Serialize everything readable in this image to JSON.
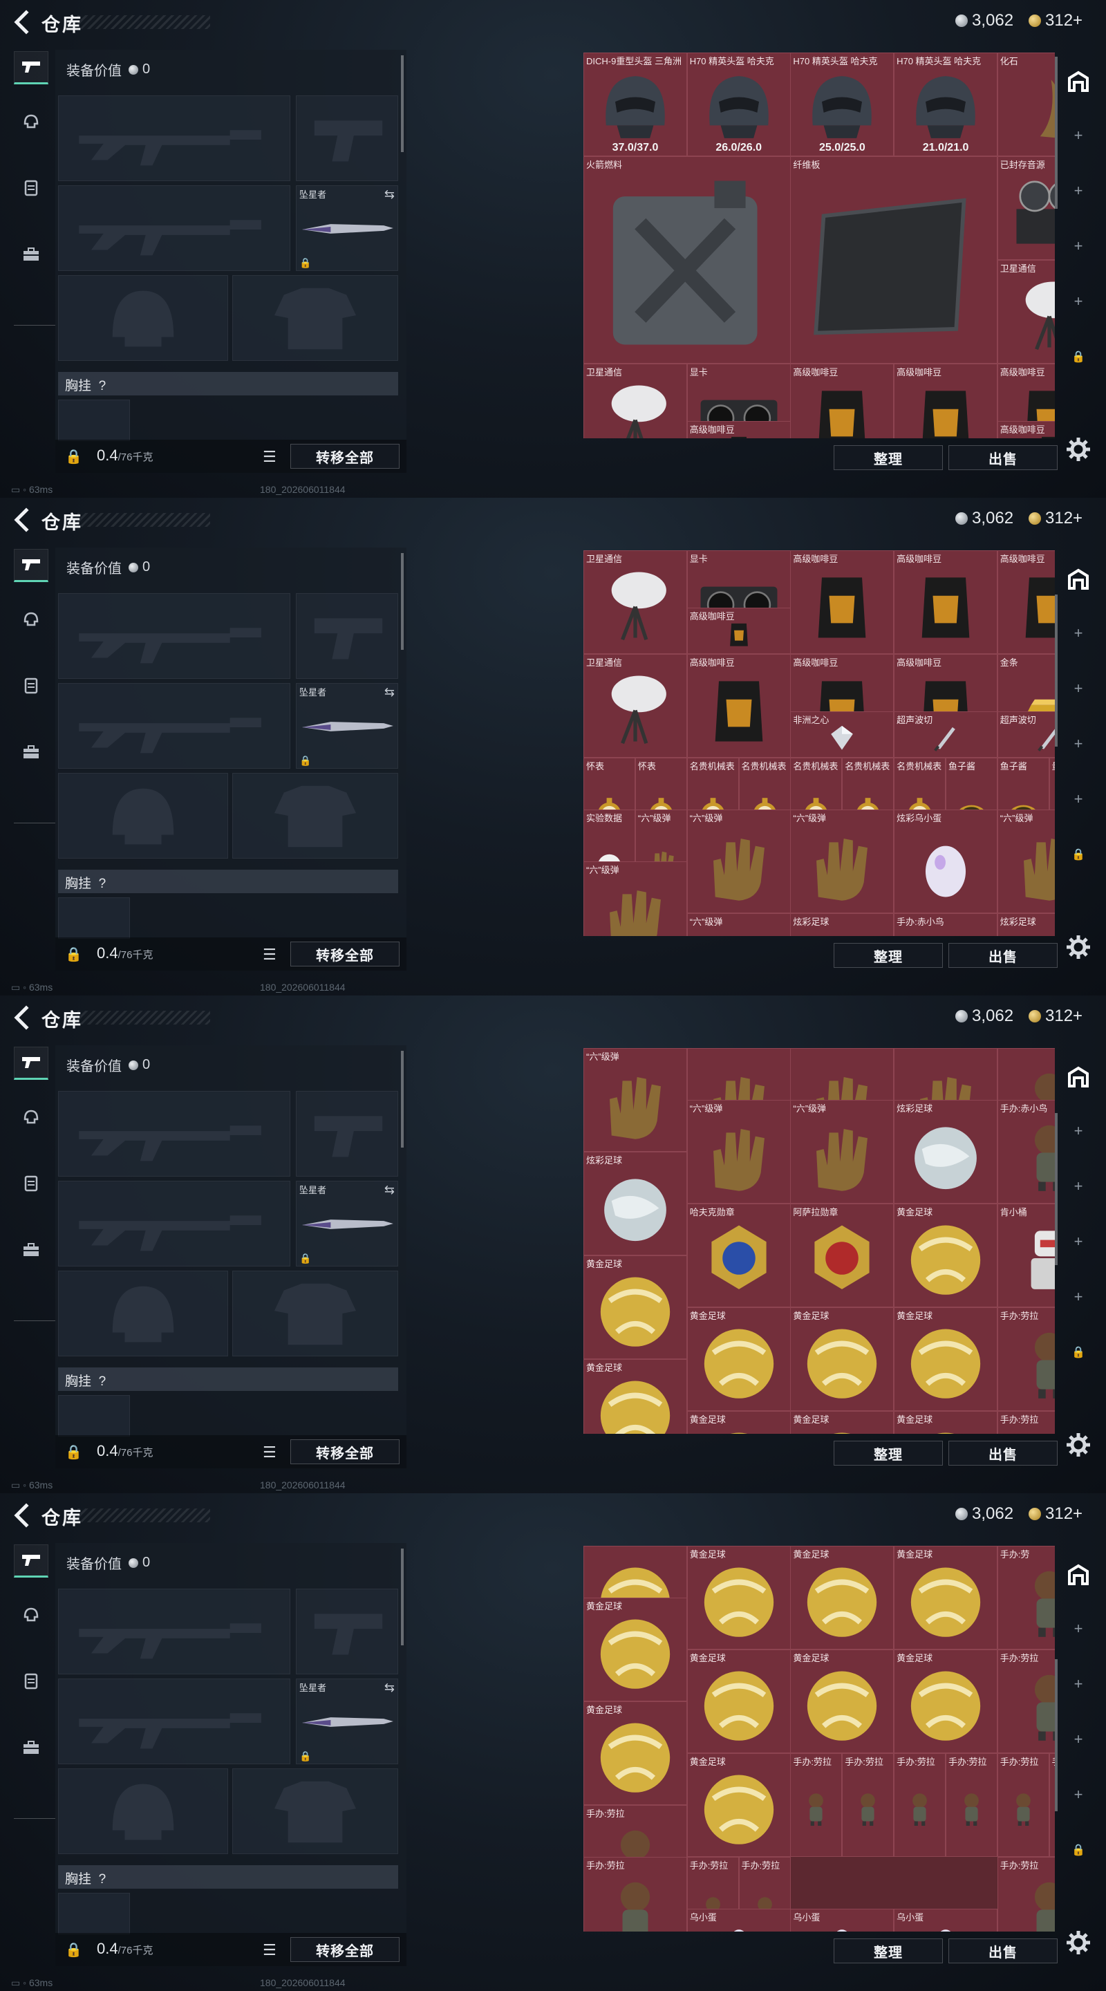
{
  "header": {
    "title": "仓库",
    "silver": "3,062",
    "gold": "312+"
  },
  "loadout": {
    "value_label": "装备价值",
    "value": "0",
    "secondary_label": "坠星者",
    "chest_label": "胸挂",
    "chest_q": "?",
    "weight": "0.4",
    "weight_max": "/76千克",
    "transfer_all": "转移全部"
  },
  "actions": {
    "sort": "整理",
    "sell": "出售"
  },
  "status": {
    "ping": "63ms",
    "build": "180_202606011844"
  },
  "storage": [
    [
      {
        "n": "DICH-9重型头盔 三角洲",
        "d": "37.0/37.0",
        "i": "helmet"
      },
      {
        "n": "H70 精英头盔 哈夫克",
        "d": "26.0/26.0",
        "i": "helmet"
      },
      {
        "n": "H70 精英头盔 哈夫克",
        "d": "25.0/25.0",
        "i": "helmet"
      },
      {
        "n": "H70 精英头盔 哈夫克",
        "d": "21.0/21.0",
        "i": "helmet"
      },
      {
        "n": "化石",
        "i": "fossil"
      },
      {
        "n": "火箭燃料",
        "i": "fuel"
      },
      {
        "n": "纤维板",
        "i": "board"
      },
      {
        "n": "已封存音源",
        "i": "reel"
      },
      {
        "n": "卫星通信",
        "i": "dish"
      },
      {
        "n": "卫星通信",
        "i": "dish"
      },
      {
        "n": "显卡",
        "i": "gpu"
      },
      {
        "n": "高级咖啡豆",
        "i": "coffee"
      },
      {
        "n": "高级咖啡豆",
        "i": "coffee"
      },
      {
        "n": "高级咖啡豆",
        "i": "coffee"
      },
      {
        "n": "高级咖啡豆",
        "i": "coffee"
      },
      {
        "n": "高级咖啡豆",
        "i": "coffee"
      },
      {
        "n": "高级咖啡豆",
        "i": "coffee"
      },
      {
        "n": "高级咖啡豆",
        "i": "coffee"
      },
      {
        "n": "金条",
        "i": "gold"
      },
      {
        "n": "非洲之心",
        "i": "gem"
      },
      {
        "n": "超声波切",
        "i": "knife"
      },
      {
        "n": "超声波切",
        "i": "knife"
      }
    ],
    [
      {
        "n": "卫星通信",
        "i": "dish"
      },
      {
        "n": "显卡",
        "i": "gpu"
      },
      {
        "n": "高级咖啡豆",
        "i": "coffee"
      },
      {
        "n": "高级咖啡豆",
        "i": "coffee"
      },
      {
        "n": "高级咖啡豆",
        "i": "coffee"
      },
      {
        "n": "卫星通信",
        "i": "dish"
      },
      {
        "n": "高级咖啡豆",
        "i": "coffee"
      },
      {
        "n": "高级咖啡豆",
        "i": "coffee"
      },
      {
        "n": "高级咖啡豆",
        "i": "coffee"
      },
      {
        "n": "高级咖啡豆",
        "i": "coffee"
      },
      {
        "n": "金条",
        "i": "gold"
      },
      {
        "n": "非洲之心",
        "i": "gem"
      },
      {
        "n": "超声波切",
        "i": "knife"
      },
      {
        "n": "超声波切",
        "i": "knife"
      },
      {
        "n": "怀表",
        "i": "watch"
      },
      {
        "n": "怀表",
        "i": "watch"
      },
      {
        "n": "名贵机械表",
        "i": "watch"
      },
      {
        "n": "名贵机械表",
        "i": "watch"
      },
      {
        "n": "名贵机械表",
        "i": "watch"
      },
      {
        "n": "名贵机械表",
        "i": "watch"
      },
      {
        "n": "名贵机械表",
        "i": "watch"
      },
      {
        "n": "鱼子酱",
        "i": "tin"
      },
      {
        "n": "鱼子酱",
        "i": "tin"
      },
      {
        "n": "量子存储",
        "i": "usb"
      },
      {
        "n": "实验数据",
        "i": "disc"
      },
      {
        "n": "“六”级弹",
        "i": "hand"
      },
      {
        "n": "“六”级弹",
        "i": "hand"
      },
      {
        "n": "“六”级弹",
        "i": "hand"
      },
      {
        "n": "炫彩乌小蛋",
        "i": "egg"
      },
      {
        "n": "“六”级弹",
        "i": "hand"
      },
      {
        "n": "“六”级弹",
        "i": "hand"
      },
      {
        "n": "“六”级弹",
        "i": "hand"
      },
      {
        "n": "炫彩足球",
        "i": "pearl"
      },
      {
        "n": "手办:赤小鸟",
        "i": "figure"
      },
      {
        "n": "炫彩足球",
        "i": "pearl"
      }
    ],
    [
      {
        "n": "“六”级弹",
        "i": "hand"
      },
      {
        "n": "",
        "i": "hand"
      },
      {
        "n": "",
        "i": "hand"
      },
      {
        "n": "",
        "i": "hand"
      },
      {
        "n": "",
        "i": "figure"
      },
      {
        "n": "“六”级弹",
        "i": "hand"
      },
      {
        "n": "“六”级弹",
        "i": "hand"
      },
      {
        "n": "炫彩足球",
        "i": "pearl"
      },
      {
        "n": "手办:赤小鸟",
        "i": "figure"
      },
      {
        "n": "炫彩足球",
        "i": "pearl"
      },
      {
        "n": "哈夫克勋章",
        "i": "medalb"
      },
      {
        "n": "阿萨拉勋章",
        "i": "medalr"
      },
      {
        "n": "黄金足球",
        "i": "ball"
      },
      {
        "n": "肯小桶",
        "i": "robot"
      },
      {
        "n": "黄金足球",
        "i": "ball"
      },
      {
        "n": "黄金足球",
        "i": "ball"
      },
      {
        "n": "黄金足球",
        "i": "ball"
      },
      {
        "n": "黄金足球",
        "i": "ball"
      },
      {
        "n": "手办:劳拉",
        "i": "figure"
      },
      {
        "n": "黄金足球",
        "i": "ball"
      },
      {
        "n": "黄金足球",
        "i": "ball"
      },
      {
        "n": "黄金足球",
        "i": "ball"
      },
      {
        "n": "黄金足球",
        "i": "ball"
      },
      {
        "n": "手办:劳拉",
        "i": "figure"
      }
    ],
    [
      {
        "n": "",
        "i": "ball"
      },
      {
        "n": "黄金足球",
        "i": "ball"
      },
      {
        "n": "黄金足球",
        "i": "ball"
      },
      {
        "n": "黄金足球",
        "i": "ball"
      },
      {
        "n": "手办:劳",
        "i": "figure"
      },
      {
        "n": "黄金足球",
        "i": "ball"
      },
      {
        "n": "黄金足球",
        "i": "ball"
      },
      {
        "n": "黄金足球",
        "i": "ball"
      },
      {
        "n": "黄金足球",
        "i": "ball"
      },
      {
        "n": "手办:劳拉",
        "i": "figure"
      },
      {
        "n": "黄金足球",
        "i": "ball"
      },
      {
        "n": "黄金足球",
        "i": "ball"
      },
      {
        "n": "手办:劳拉",
        "i": "figure"
      },
      {
        "n": "手办:劳拉",
        "i": "figure"
      },
      {
        "n": "手办:劳拉",
        "i": "figure"
      },
      {
        "n": "手办:劳拉",
        "i": "figure"
      },
      {
        "n": "手办:劳拉",
        "i": "figure"
      },
      {
        "n": "手办:劳拉",
        "i": "figure"
      },
      {
        "n": "手办:劳拉",
        "i": "figure"
      },
      {
        "n": "手办:劳拉",
        "i": "figure"
      },
      {
        "n": "手办:劳拉",
        "i": "figure"
      },
      {
        "n": "手办:劳拉",
        "i": "figure"
      },
      {
        "n": "手办:劳拉",
        "i": "figure"
      },
      {
        "n": "乌小蛋",
        "i": "egg"
      },
      {
        "n": "乌小蛋",
        "i": "egg"
      },
      {
        "n": "乌小蛋",
        "i": "egg"
      }
    ]
  ]
}
